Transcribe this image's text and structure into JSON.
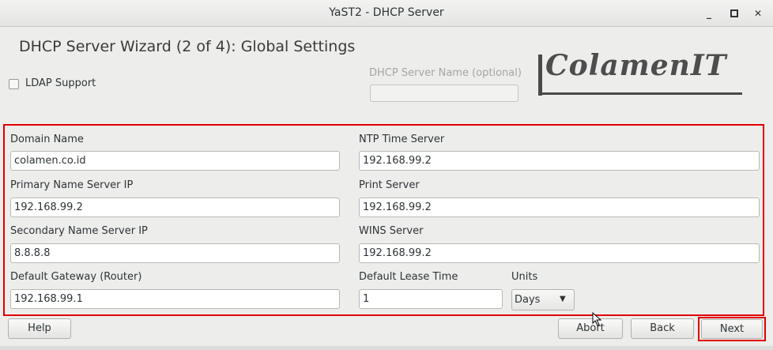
{
  "window": {
    "title": "YaST2 - DHCP Server"
  },
  "headline": "DHCP Server Wizard (2 of 4): Global Settings",
  "ldap": {
    "label": "LDAP Support",
    "checked": false
  },
  "server_name": {
    "label": "DHCP Server Name (optional)",
    "value": ""
  },
  "logo_text": "ColamenIT",
  "fields": {
    "domain_name": {
      "label": "Domain Name",
      "value": "colamen.co.id"
    },
    "primary_ns": {
      "label": "Primary Name Server IP",
      "value": "192.168.99.2"
    },
    "secondary_ns": {
      "label": "Secondary Name Server IP",
      "value": "8.8.8.8"
    },
    "gateway": {
      "label": "Default Gateway (Router)",
      "value": "192.168.99.1"
    },
    "ntp": {
      "label": "NTP Time Server",
      "value": "192.168.99.2"
    },
    "print": {
      "label": "Print Server",
      "value": "192.168.99.2"
    },
    "wins": {
      "label": "WINS Server",
      "value": "192.168.99.2"
    },
    "lease_time": {
      "label": "Default Lease Time",
      "value": "1"
    },
    "units": {
      "label": "Units",
      "value": "Days"
    }
  },
  "buttons": {
    "help": "Help",
    "abort": "Abort",
    "back": "Back",
    "next": "Next"
  },
  "colors": {
    "highlight": "#e00000",
    "background": "#ededec"
  }
}
